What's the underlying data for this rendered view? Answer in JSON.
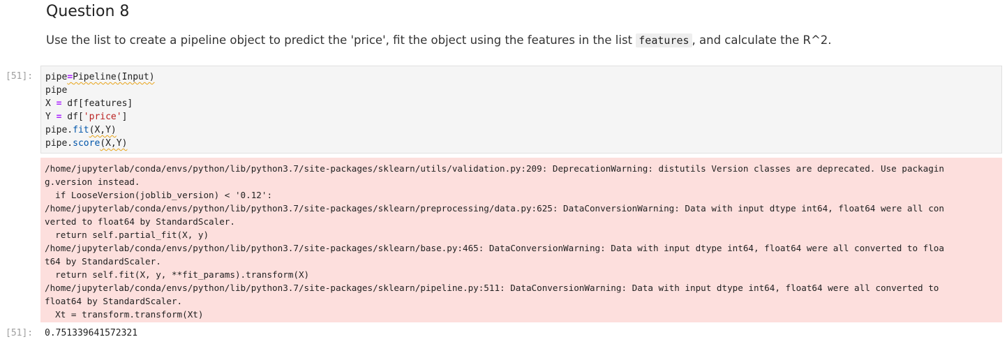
{
  "markdown": {
    "heading": "Question 8",
    "desc_before": "Use the list to create a pipeline object to predict the 'price', fit the object using the features in the list ",
    "desc_code": "features",
    "desc_after": ", and calculate the R^2."
  },
  "code_cell": {
    "prompt_in": "[51]:",
    "prompt_out": "[51]:",
    "lines": [
      {
        "a": "pipe",
        "op": "=",
        "b": "Pipeline(Input)"
      },
      {
        "a": "pipe"
      },
      {
        "a": "X ",
        "op": "=",
        "b": " df[features]"
      },
      {
        "a": "Y ",
        "op": "=",
        "b": " df[",
        "str": "'price'",
        "c": "]"
      },
      {
        "a": "pipe.",
        "attr": "fit",
        "b": "(X,Y)"
      },
      {
        "a": "pipe.",
        "attr": "score",
        "b": "(X,Y)"
      }
    ],
    "stderr_lines": [
      "/home/jupyterlab/conda/envs/python/lib/python3.7/site-packages/sklearn/utils/validation.py:209: DeprecationWarning: distutils Version classes are deprecated. Use packagin",
      "g.version instead.",
      "  if LooseVersion(joblib_version) < '0.12':",
      "/home/jupyterlab/conda/envs/python/lib/python3.7/site-packages/sklearn/preprocessing/data.py:625: DataConversionWarning: Data with input dtype int64, float64 were all con",
      "verted to float64 by StandardScaler.",
      "  return self.partial_fit(X, y)",
      "/home/jupyterlab/conda/envs/python/lib/python3.7/site-packages/sklearn/base.py:465: DataConversionWarning: Data with input dtype int64, float64 were all converted to floa",
      "t64 by StandardScaler.",
      "  return self.fit(X, y, **fit_params).transform(X)",
      "/home/jupyterlab/conda/envs/python/lib/python3.7/site-packages/sklearn/pipeline.py:511: DataConversionWarning: Data with input dtype int64, float64 were all converted to",
      "float64 by StandardScaler.",
      "  Xt = transform.transform(Xt)"
    ],
    "result": "0.751339641572321"
  },
  "colors": {
    "stderr_bg": "#fddfdd",
    "input_bg": "#f5f5f5",
    "string": "#ba2121",
    "operator": "#aa22ff",
    "attribute": "#0055aa"
  }
}
